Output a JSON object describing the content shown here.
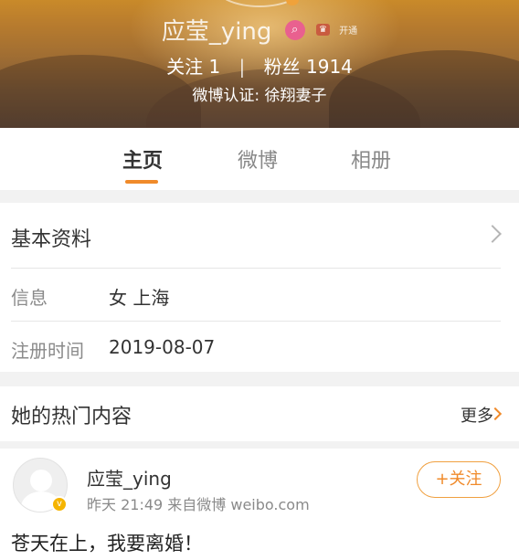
{
  "profile": {
    "name": "应莹_ying",
    "vip_text": "开通",
    "following_label": "关注",
    "following_count": "1",
    "followers_label": "粉丝",
    "followers_count": "1914",
    "verification": "微博认证: 徐翔妻子"
  },
  "tabs": [
    {
      "label": "主页",
      "active": true
    },
    {
      "label": "微博",
      "active": false
    },
    {
      "label": "相册",
      "active": false
    }
  ],
  "basic_info": {
    "title": "基本资料",
    "rows": [
      {
        "label": "信息",
        "value": "女  上海"
      },
      {
        "label": "注册时间",
        "value": "2019-08-07"
      }
    ]
  },
  "hot_content": {
    "title": "她的热门内容",
    "more_label": "更多"
  },
  "post": {
    "author": "应莹_ying",
    "meta": "昨天 21:49  来自微博 weibo.com",
    "follow_label": "+关注",
    "text": "苍天在上，我要离婚！"
  },
  "colors": {
    "accent": "#f08a2a",
    "tab_indicator": "#f08a2a",
    "separator": "#f2f2f2"
  },
  "icons": {
    "search_badge": "search-icon",
    "verified": "verified-badge-icon",
    "chevron": "chevron-right-icon"
  }
}
